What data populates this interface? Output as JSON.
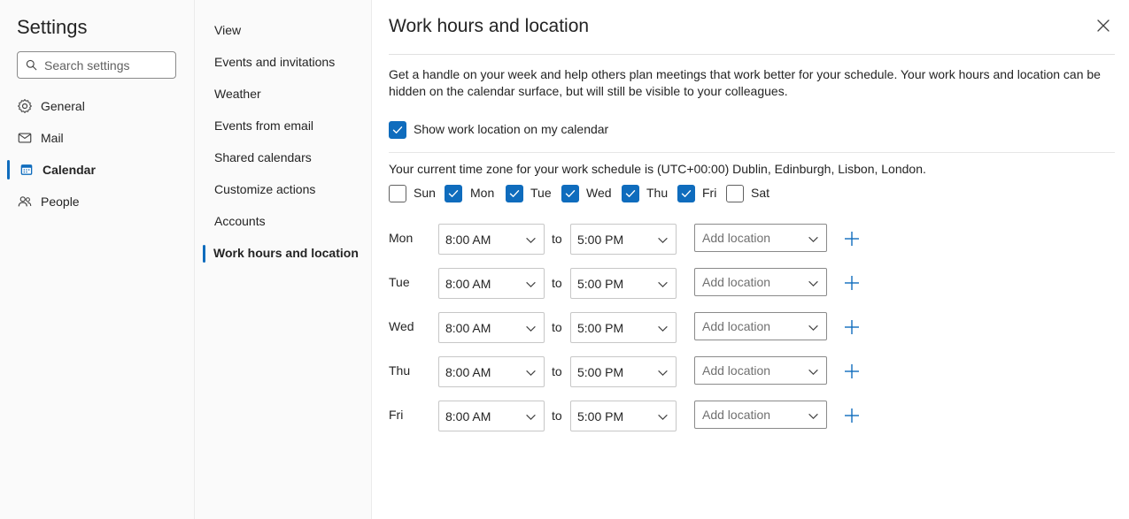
{
  "left_nav": {
    "title": "Settings",
    "search_placeholder": "Search settings",
    "items": [
      {
        "label": "General",
        "icon": "gear-icon"
      },
      {
        "label": "Mail",
        "icon": "mail-icon"
      },
      {
        "label": "Calendar",
        "icon": "calendar-icon",
        "active": true
      },
      {
        "label": "People",
        "icon": "people-icon"
      }
    ]
  },
  "sub_nav": {
    "items": [
      {
        "label": "View"
      },
      {
        "label": "Events and invitations"
      },
      {
        "label": "Weather"
      },
      {
        "label": "Events from email"
      },
      {
        "label": "Shared calendars"
      },
      {
        "label": "Customize actions"
      },
      {
        "label": "Accounts"
      },
      {
        "label": "Work hours and location",
        "active": true
      }
    ]
  },
  "main": {
    "title": "Work hours and location",
    "description": "Get a handle on your week and help others plan meetings that work better for your schedule. Your work hours and location can be hidden on the calendar surface, but will still be visible to your colleagues.",
    "show_location": {
      "label": "Show work location on my calendar",
      "checked": true
    },
    "timezone_text": "Your current time zone for your work schedule is (UTC+00:00) Dublin, Edinburgh, Lisbon, London.",
    "days": [
      {
        "label": "Sun",
        "checked": false
      },
      {
        "label": "Mon",
        "checked": true
      },
      {
        "label": "Tue",
        "checked": true
      },
      {
        "label": "Wed",
        "checked": true
      },
      {
        "label": "Thu",
        "checked": true
      },
      {
        "label": "Fri",
        "checked": true
      },
      {
        "label": "Sat",
        "checked": false
      }
    ],
    "to_label": "to",
    "schedule": [
      {
        "day": "Mon",
        "start": "8:00 AM",
        "end": "5:00 PM",
        "location_placeholder": "Add location"
      },
      {
        "day": "Tue",
        "start": "8:00 AM",
        "end": "5:00 PM",
        "location_placeholder": "Add location"
      },
      {
        "day": "Wed",
        "start": "8:00 AM",
        "end": "5:00 PM",
        "location_placeholder": "Add location"
      },
      {
        "day": "Thu",
        "start": "8:00 AM",
        "end": "5:00 PM",
        "location_placeholder": "Add location"
      },
      {
        "day": "Fri",
        "start": "8:00 AM",
        "end": "5:00 PM",
        "location_placeholder": "Add location"
      }
    ]
  },
  "colors": {
    "accent": "#0f6cbd",
    "pane_bg": "#fafafa"
  }
}
